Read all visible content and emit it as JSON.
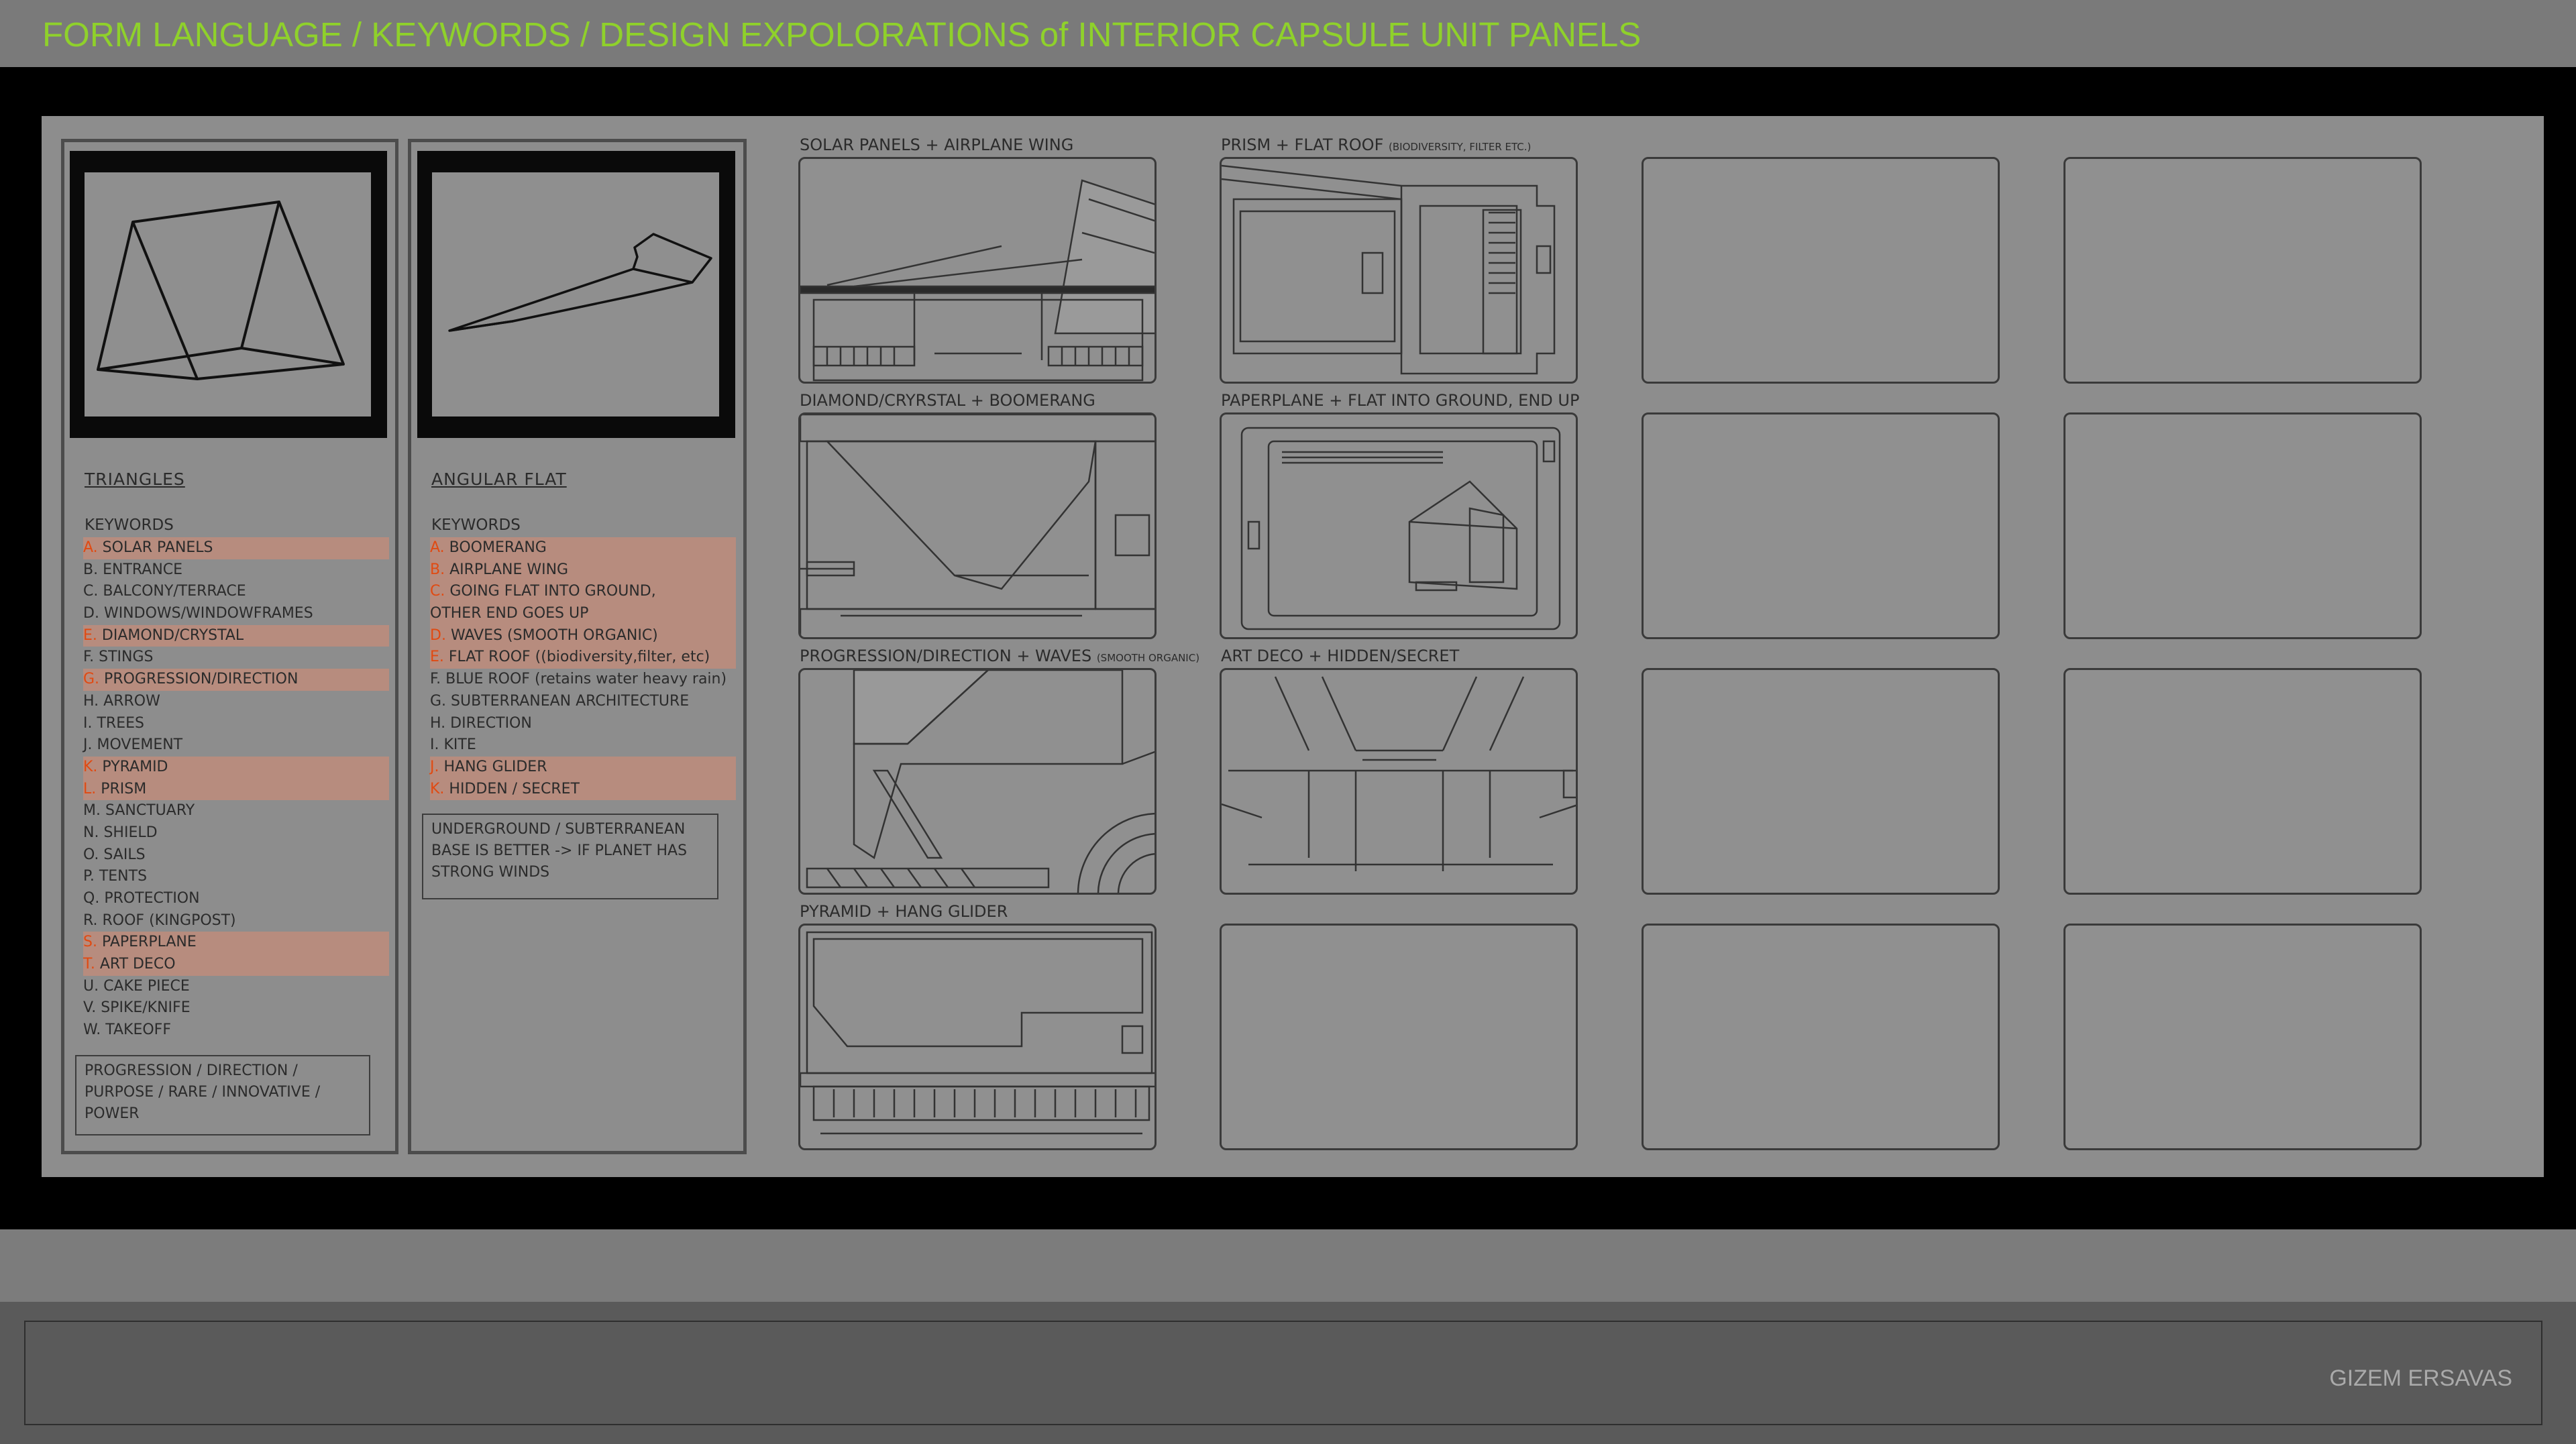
{
  "header": {
    "title": "FORM LANGUAGE / KEYWORDS / DESIGN EXPOLORATIONS of INTERIOR CAPSULE UNIT PANELS"
  },
  "footer": {
    "author": "GIZEM ERSAVAS"
  },
  "colors": {
    "title_green": "#8fd12b",
    "highlight": "#b78c7e",
    "highlight_letter": "#e04a12"
  },
  "columns": [
    {
      "icon": "triangle-prism-icon",
      "heading": "TRIANGLES",
      "keywords_label": "KEYWORDS",
      "keywords": [
        {
          "letter": "A.",
          "text": "SOLAR PANELS",
          "highlighted": true
        },
        {
          "letter": "B.",
          "text": "ENTRANCE",
          "highlighted": false
        },
        {
          "letter": "C.",
          "text": "BALCONY/TERRACE",
          "highlighted": false
        },
        {
          "letter": "D.",
          "text": "WINDOWS/WINDOWFRAMES",
          "highlighted": false
        },
        {
          "letter": "E.",
          "text": "DIAMOND/CRYSTAL",
          "highlighted": true
        },
        {
          "letter": "F.",
          "text": "STINGS",
          "highlighted": false
        },
        {
          "letter": "G.",
          "text": "PROGRESSION/DIRECTION",
          "highlighted": true
        },
        {
          "letter": "H.",
          "text": "ARROW",
          "highlighted": false
        },
        {
          "letter": "I.",
          "text": "TREES",
          "highlighted": false
        },
        {
          "letter": "J.",
          "text": "MOVEMENT",
          "highlighted": false
        },
        {
          "letter": "K.",
          "text": "PYRAMID",
          "highlighted": true
        },
        {
          "letter": "L.",
          "text": "PRISM",
          "highlighted": true
        },
        {
          "letter": "M.",
          "text": "SANCTUARY",
          "highlighted": false
        },
        {
          "letter": "N.",
          "text": "SHIELD",
          "highlighted": false
        },
        {
          "letter": "O.",
          "text": "SAILS",
          "highlighted": false
        },
        {
          "letter": "P.",
          "text": "TENTS",
          "highlighted": false
        },
        {
          "letter": "Q.",
          "text": "PROTECTION",
          "highlighted": false
        },
        {
          "letter": "R.",
          "text": "ROOF (KINGPOST)",
          "highlighted": false
        },
        {
          "letter": "S.",
          "text": "PAPERPLANE",
          "highlighted": true
        },
        {
          "letter": "T.",
          "text": "ART DECO",
          "highlighted": true
        },
        {
          "letter": "U.",
          "text": "CAKE PIECE",
          "highlighted": false
        },
        {
          "letter": "V.",
          "text": "SPIKE/KNIFE",
          "highlighted": false
        },
        {
          "letter": "W.",
          "text": "TAKEOFF",
          "highlighted": false
        }
      ],
      "note": "PROGRESSION / DIRECTION / PURPOSE / RARE / INNOVATIVE / POWER"
    },
    {
      "icon": "boomerang-icon",
      "heading": "ANGULAR FLAT",
      "keywords_label": "KEYWORDS",
      "keywords": [
        {
          "letter": "A.",
          "text": "BOOMERANG",
          "highlighted": true
        },
        {
          "letter": "B.",
          "text": "AIRPLANE WING",
          "highlighted": true
        },
        {
          "letter": "C.",
          "text": "GOING FLAT INTO GROUND,",
          "highlighted": true
        },
        {
          "letter": "",
          "text": "OTHER END GOES UP",
          "highlighted": true
        },
        {
          "letter": "D.",
          "text": "WAVES (SMOOTH ORGANIC)",
          "highlighted": true
        },
        {
          "letter": "E.",
          "text": "FLAT ROOF ((biodiversity,filter, etc)",
          "highlighted": true
        },
        {
          "letter": "F.",
          "text": "BLUE ROOF (retains water heavy rain)",
          "highlighted": false
        },
        {
          "letter": "G.",
          "text": "SUBTERRANEAN ARCHITECTURE",
          "highlighted": false
        },
        {
          "letter": "H.",
          "text": "DIRECTION",
          "highlighted": false
        },
        {
          "letter": "I.",
          "text": "KITE",
          "highlighted": false
        },
        {
          "letter": "J.",
          "text": "HANG GLIDER",
          "highlighted": true
        },
        {
          "letter": "K.",
          "text": "HIDDEN / SECRET",
          "highlighted": true
        }
      ],
      "note": "UNDERGROUND / SUBTERRANEAN BASE IS BETTER -> IF PLANET HAS STRONG WINDS"
    }
  ],
  "explorations": [
    {
      "label": "SOLAR PANELS + AIRPLANE WING",
      "small": "",
      "sketch": "solar"
    },
    {
      "label": "PRISM + FLAT ROOF",
      "small": "(BIODIVERSITY, FILTER ETC.)",
      "sketch": "prism"
    },
    {
      "label": "",
      "small": "",
      "sketch": "empty"
    },
    {
      "label": "",
      "small": "",
      "sketch": "empty"
    },
    {
      "label": "DIAMOND/CRYRSTAL + BOOMERANG",
      "small": "",
      "sketch": "diamond"
    },
    {
      "label": "PAPERPLANE + FLAT INTO GROUND, END UP",
      "small": "",
      "sketch": "paperplane"
    },
    {
      "label": "",
      "small": "",
      "sketch": "empty"
    },
    {
      "label": "",
      "small": "",
      "sketch": "empty"
    },
    {
      "label": "PROGRESSION/DIRECTION + WAVES",
      "small": "(SMOOTH ORGANIC)",
      "sketch": "progression"
    },
    {
      "label": "ART DECO + HIDDEN/SECRET",
      "small": "",
      "sketch": "artdeco"
    },
    {
      "label": "",
      "small": "",
      "sketch": "empty"
    },
    {
      "label": "",
      "small": "",
      "sketch": "empty"
    },
    {
      "label": "PYRAMID + HANG GLIDER",
      "small": "",
      "sketch": "pyramid"
    },
    {
      "label": "",
      "small": "",
      "sketch": "empty"
    },
    {
      "label": "",
      "small": "",
      "sketch": "empty"
    },
    {
      "label": "",
      "small": "",
      "sketch": "empty"
    }
  ]
}
